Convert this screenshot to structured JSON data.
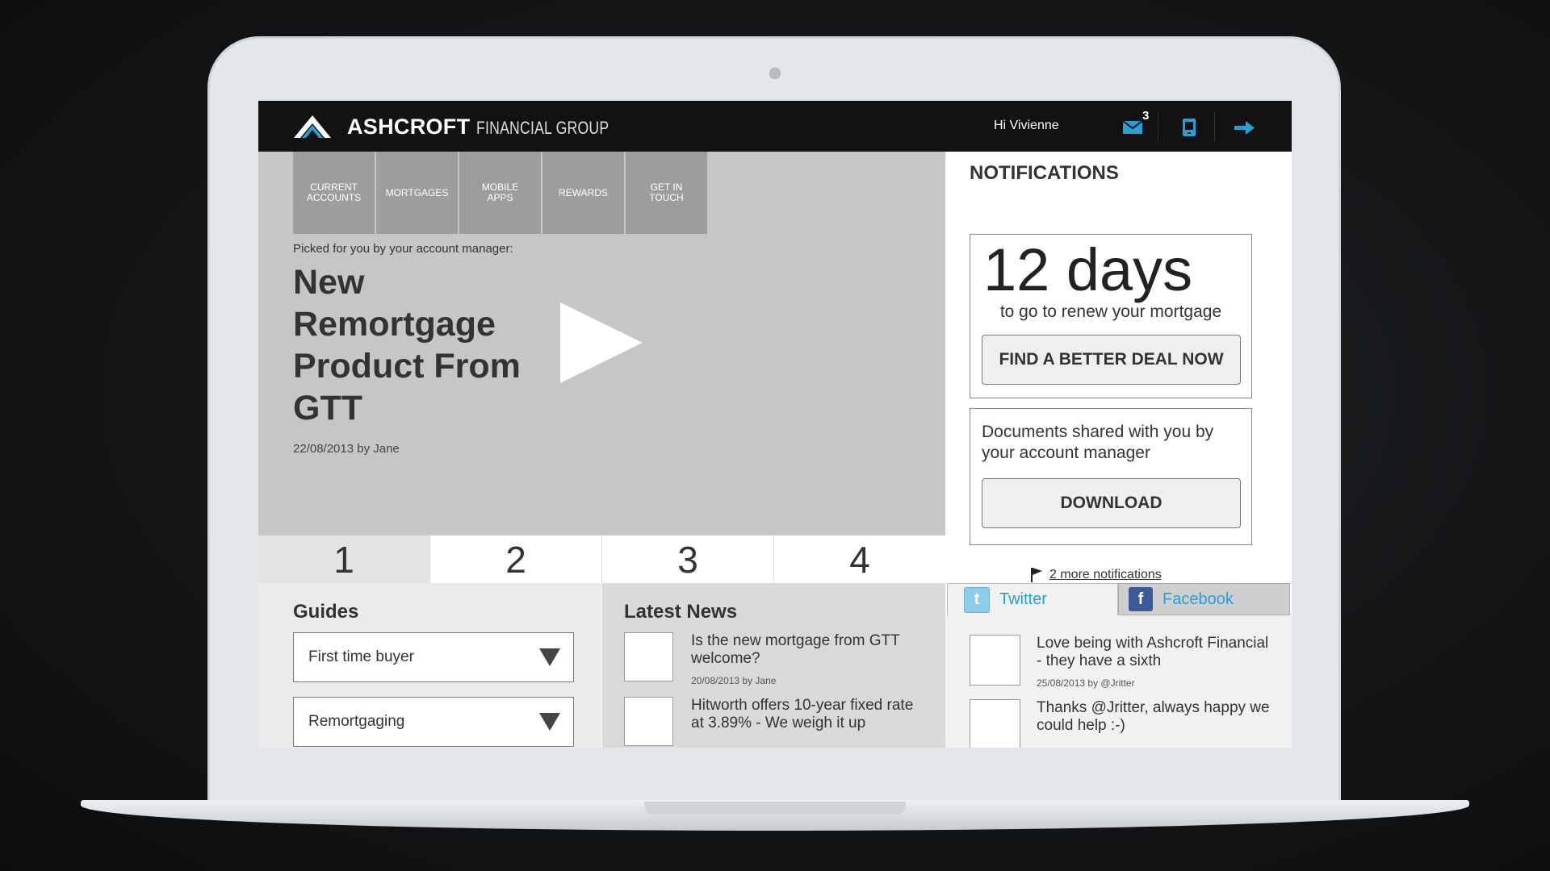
{
  "header": {
    "brand_bold": "ASHCROFT",
    "brand_light": "FINANCIAL GROUP",
    "greeting": "Hi Vivienne",
    "mail_count": "3",
    "icons": [
      "mail-icon",
      "mobile-icon",
      "logout-arrow-icon"
    ]
  },
  "nav": {
    "items": [
      {
        "label": "CURRENT\nACCOUNTS"
      },
      {
        "label": "MORTGAGES"
      },
      {
        "label": "MOBILE\nAPPS"
      },
      {
        "label": "REWARDS"
      },
      {
        "label": "GET IN\nTOUCH"
      }
    ]
  },
  "hero": {
    "picked_label": "Picked for you by your account manager:",
    "title": "New Remortgage Product From GTT",
    "byline": "22/08/2013 by Jane"
  },
  "pager": {
    "pages": [
      "1",
      "2",
      "3",
      "4"
    ],
    "active": "1"
  },
  "guides": {
    "title": "Guides",
    "selects": [
      {
        "value": "First time buyer"
      },
      {
        "value": "Remortgaging"
      }
    ]
  },
  "news": {
    "title": "Latest News",
    "items": [
      {
        "text": "Is the new mortgage from GTT welcome?",
        "meta": "20/08/2013 by Jane"
      },
      {
        "text": "Hitworth offers 10-year fixed rate at 3.89% - We weigh it up",
        "meta": ""
      }
    ]
  },
  "notifications": {
    "title": "NOTIFICATIONS",
    "days": "12 days",
    "renew_text": "to go to renew your mortgage",
    "find_deal_button": "FIND A BETTER DEAL NOW",
    "documents_text": "Documents shared with you by your account manager",
    "download_button": "DOWNLOAD",
    "more_link": "2 more notifications"
  },
  "social": {
    "tabs": [
      {
        "label": "Twitter",
        "icon": "twitter-icon"
      },
      {
        "label": "Facebook",
        "icon": "facebook-icon"
      }
    ],
    "active_tab": "Twitter",
    "tweets": [
      {
        "text": "Love being with Ashcroft Financial - they have a sixth",
        "meta": "25/08/2013 by @Jritter"
      },
      {
        "text": "Thanks @Jritter, always happy we could help :-)",
        "meta": ""
      }
    ]
  },
  "colors": {
    "topbar": "#121212",
    "accent_blue": "#2a9fd6",
    "hero_bg": "#c6c6c6",
    "nav_bg": "#9d9d9d"
  }
}
